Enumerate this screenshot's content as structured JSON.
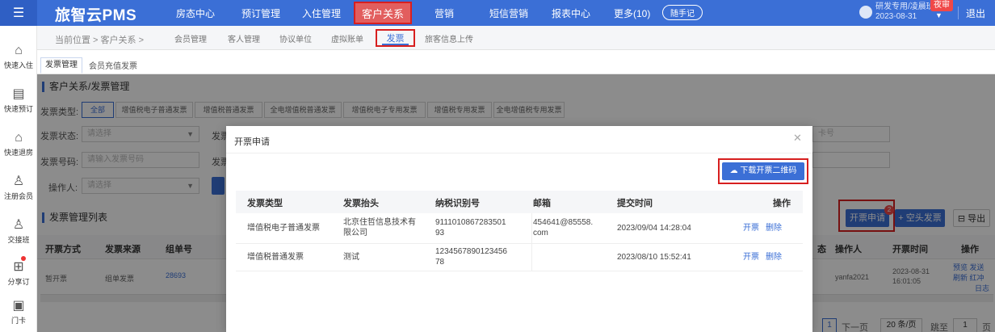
{
  "topbar": {
    "brand": "旅智云PMS",
    "nav": [
      "房态中心",
      "预订管理",
      "入住管理",
      "客户关系",
      "营销",
      "短信营销",
      "报表中心",
      "更多(10)"
    ],
    "active_nav": "客户关系",
    "memo": "随手记",
    "user_line1": "研发专用/凌晨班",
    "user_line2": "2023-08-31",
    "night_badge": "夜审",
    "logout": "退出"
  },
  "sidebar": {
    "items": [
      "快速入住",
      "快速预订",
      "快速退房",
      "注册会员",
      "交接班",
      "分享订",
      "门卡"
    ]
  },
  "breadcrumb": {
    "text": "当前位置 > 客户关系 >",
    "subnav": [
      "会员管理",
      "客人管理",
      "协议单位",
      "虚拟账单",
      "发票",
      "旅客信息上传"
    ],
    "active": "发票"
  },
  "page_tabs": [
    "发票管理",
    "会员充值发票"
  ],
  "filters": {
    "section_title": "客户关系/发票管理",
    "type_label": "发票类型:",
    "types": [
      "全部",
      "增值税电子普通发票",
      "增值税普通发票",
      "全电增值税普通发票",
      "增值税电子专用发票",
      "增值税专用发票",
      "全电增值税专用发票"
    ],
    "status_label": "发票状态:",
    "status_placeholder": "请选择",
    "number_label": "发票号码:",
    "number_placeholder": "请输入发票号码",
    "operator_label": "操作人:",
    "operator_placeholder": "请选择",
    "partial_label": "发票",
    "card_placeholder": "卡号"
  },
  "list": {
    "title": "发票管理列表",
    "apply_btn": "开票申请",
    "apply_badge": "2",
    "blank_btn": "+ 空头发票",
    "export_btn": "导出",
    "columns": [
      "开票方式",
      "发票来源",
      "组单号",
      "态",
      "操作人",
      "开票时间",
      "操作"
    ],
    "row": {
      "method": "暂开票",
      "source": "组单发票",
      "order_no": "28693",
      "operator": "yanfa2021",
      "date": "2023-08-31",
      "time": "16:01:05",
      "actions_line1": "预览 发送",
      "actions_line2": "刷新 红冲",
      "actions_line3": "日志"
    },
    "pager": {
      "current": "1",
      "next": "下一页",
      "per_page": "20 条/页",
      "goto": "跳至",
      "goto_value": "1",
      "page_suffix": "页"
    }
  },
  "modal": {
    "title": "开票申请",
    "download_btn": "下载开票二维码",
    "columns": [
      "发票类型",
      "发票抬头",
      "纳税识别号",
      "邮箱",
      "提交时间",
      "操作"
    ],
    "rows": [
      {
        "type": "增值税电子普通发票",
        "title_l1": "北京住哲信息技术有",
        "title_l2": "限公司",
        "tax_l1": "9111010867283501",
        "tax_l2": "93",
        "email_l1": "454641@85558.",
        "email_l2": "com",
        "time": "2023/09/04 14:28:04",
        "op_issue": "开票",
        "op_delete": "删除"
      },
      {
        "type": "增值税普通发票",
        "title_l1": "测试",
        "title_l2": "",
        "tax_l1": "1234567890123456",
        "tax_l2": "78",
        "email_l1": "",
        "email_l2": "",
        "time": "2023/08/10 15:52:41",
        "op_issue": "开票",
        "op_delete": "删除"
      }
    ]
  },
  "colors": {
    "primary": "#3b6fd6",
    "highlight": "#d71f1f"
  }
}
